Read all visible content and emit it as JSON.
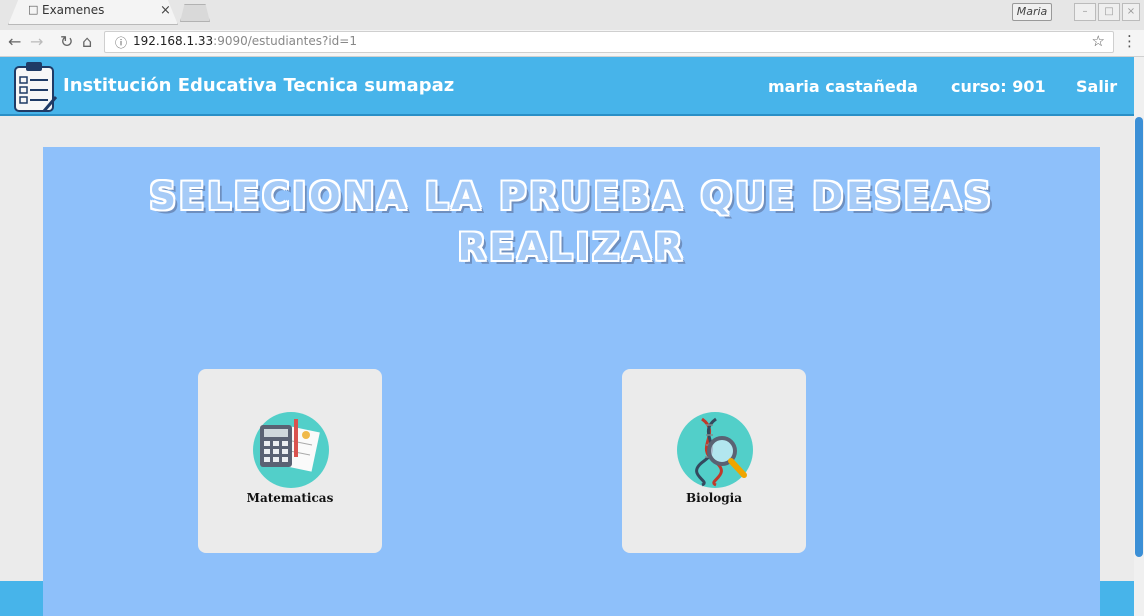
{
  "browser": {
    "tab_title": "Examenes",
    "tab_close": "×",
    "user_badge": "Maria",
    "url_host": "192.168.1.33",
    "url_rest": ":9090/estudiantes?id=1",
    "icons": [
      "back-arrow-icon",
      "forward-arrow-icon",
      "reload-icon",
      "home-icon",
      "info-icon",
      "star-icon",
      "menu-dots-icon"
    ]
  },
  "header": {
    "brand": "Institución Educativa Tecnica sumapaz",
    "user_name": "maria castañeda",
    "course": "curso: 901",
    "logout": "Salir",
    "color": "#47b4ea"
  },
  "main": {
    "heading": "SELECIONA LA PRUEBA QUE DESEAS REALIZAR",
    "panel_color": "#8ec0fa",
    "cards": [
      {
        "label": "Matematicas",
        "icon": "calculator-icon"
      },
      {
        "label": "Biologia",
        "icon": "dna-magnifier-icon"
      }
    ]
  }
}
